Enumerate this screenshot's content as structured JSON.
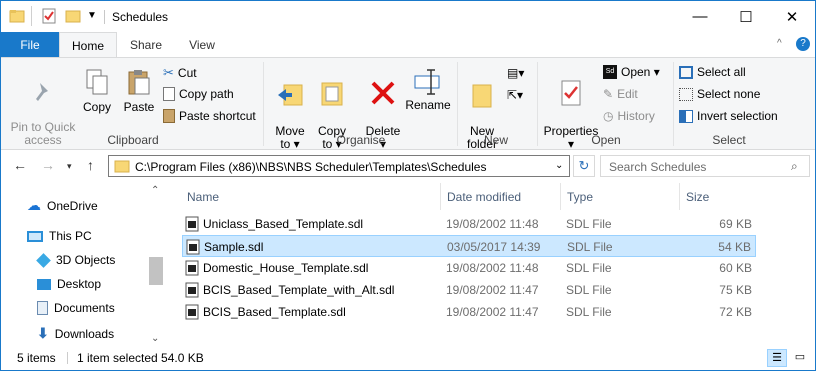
{
  "window": {
    "title": "Schedules"
  },
  "caption": {
    "minimize": "—",
    "maximize": "☐",
    "close": "✕"
  },
  "tabs": [
    {
      "label": "File"
    },
    {
      "label": "Home"
    },
    {
      "label": "Share"
    },
    {
      "label": "View"
    }
  ],
  "ribbon": {
    "clipboard": {
      "label": "Clipboard",
      "pin": "Pin to Quick\naccess",
      "copy": "Copy",
      "paste": "Paste",
      "cut": "Cut",
      "copy_path": "Copy path",
      "paste_shortcut": "Paste shortcut"
    },
    "organise": {
      "label": "Organise",
      "move_to": "Move\nto ▾",
      "copy_to": "Copy\nto ▾",
      "delete": "Delete\n▾",
      "rename": "Rename"
    },
    "new": {
      "label": "New",
      "new_folder": "New\nfolder"
    },
    "open": {
      "label": "Open",
      "properties": "Properties\n▾",
      "open": "Open ▾",
      "edit": "Edit",
      "history": "History"
    },
    "select": {
      "label": "Select",
      "select_all": "Select all",
      "select_none": "Select none",
      "invert": "Invert selection"
    }
  },
  "address": {
    "path": "C:\\Program Files (x86)\\NBS\\NBS Scheduler\\Templates\\Schedules",
    "search_placeholder": "Search Schedules"
  },
  "nav": {
    "items": [
      {
        "label": "OneDrive",
        "icon": "cloud-icon"
      },
      {
        "label": "This PC",
        "icon": "computer-icon"
      },
      {
        "label": "3D Objects",
        "icon": "cube-icon"
      },
      {
        "label": "Desktop",
        "icon": "desktop-icon"
      },
      {
        "label": "Documents",
        "icon": "documents-icon"
      },
      {
        "label": "Downloads",
        "icon": "downloads-icon"
      }
    ]
  },
  "columns": {
    "name": "Name",
    "date": "Date modified",
    "type": "Type",
    "size": "Size"
  },
  "files": [
    {
      "name": "Uniclass_Based_Template.sdl",
      "date": "19/08/2002 11:48",
      "type": "SDL File",
      "size": "69 KB"
    },
    {
      "name": "Sample.sdl",
      "date": "03/05/2017 14:39",
      "type": "SDL File",
      "size": "54 KB",
      "selected": true
    },
    {
      "name": "Domestic_House_Template.sdl",
      "date": "19/08/2002 11:48",
      "type": "SDL File",
      "size": "60 KB"
    },
    {
      "name": "BCIS_Based_Template_with_Alt.sdl",
      "date": "19/08/2002 11:47",
      "type": "SDL File",
      "size": "75 KB"
    },
    {
      "name": "BCIS_Based_Template.sdl",
      "date": "19/08/2002 11:47",
      "type": "SDL File",
      "size": "72 KB"
    }
  ],
  "status": {
    "count": "5 items",
    "selection": "1 item selected  54.0 KB"
  },
  "colors": {
    "accent": "#1979ca",
    "selection": "#cce8ff",
    "folder": "#f8d775"
  }
}
